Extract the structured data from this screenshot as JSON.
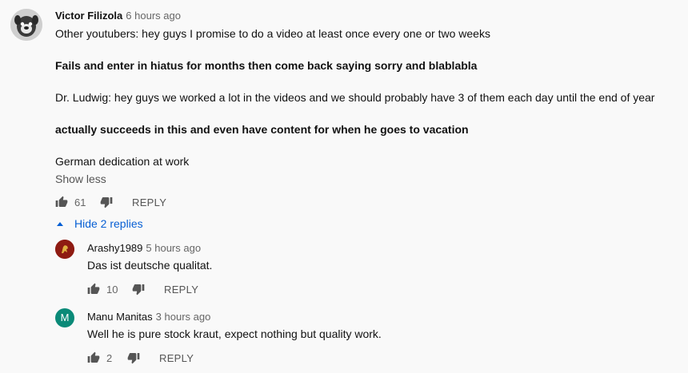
{
  "main_comment": {
    "author": "Victor Filizola",
    "time": "6 hours ago",
    "lines": [
      {
        "text": "Other youtubers: hey guys I promise to do a video at least once every one or two weeks",
        "bold": false
      },
      {
        "text": "Fails and enter in hiatus for months then come back saying sorry and blablabla",
        "bold": true
      },
      {
        "text": "Dr. Ludwig: hey guys we worked a lot in the videos and we should probably have 3 of them each day until the end of year",
        "bold": false
      },
      {
        "text": "actually succeeds in this and even have content for when he goes to vacation",
        "bold": true
      },
      {
        "text": "German dedication at work",
        "bold": false
      }
    ],
    "show_less": "Show less",
    "likes": "61",
    "reply_label": "REPLY"
  },
  "hide_replies_label": "Hide 2 replies",
  "replies": [
    {
      "author": "Arashy1989",
      "time": "5 hours ago",
      "text": "Das ist deutsche qualitat.",
      "likes": "10",
      "reply_label": "REPLY"
    },
    {
      "author": "Manu Manitas",
      "time": "3 hours ago",
      "avatar_letter": "M",
      "text": "Well he is pure stock kraut, expect nothing but quality work.",
      "likes": "2",
      "reply_label": "REPLY",
      "avatar_color": "#0a8a78"
    }
  ],
  "colors": {
    "link": "#065fd4",
    "background": "#f9f9f9",
    "secondary_text": "#666666"
  },
  "icons": [
    "thumbs-up-icon",
    "thumbs-down-icon",
    "caret-up-icon"
  ]
}
